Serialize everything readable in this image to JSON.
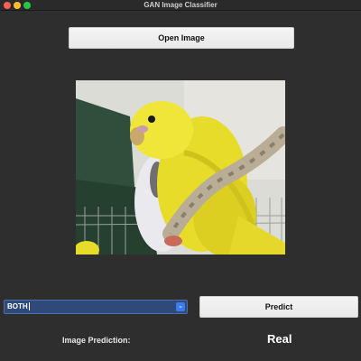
{
  "window": {
    "title": "GAN Image Classifier"
  },
  "open_button": {
    "label": "Open Image"
  },
  "image": {
    "subject": "yellow budgerigar on a perch"
  },
  "model_select": {
    "value": "BOTH",
    "icon": "chevron-updown-icon"
  },
  "predict_button": {
    "label": "Predict"
  },
  "prediction": {
    "label": "Image Prediction:",
    "value": "Real"
  },
  "colors": {
    "background": "#2e2e2e",
    "select_bg": "#2f4a7a",
    "select_arrow": "#3d7cf0",
    "close": "#ff5f57",
    "minimize": "#febc2e",
    "maximize": "#28c840"
  }
}
